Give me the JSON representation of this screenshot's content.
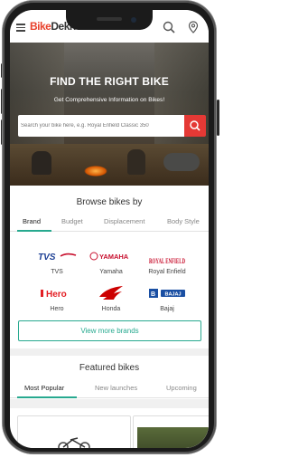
{
  "header": {
    "logo_a": "Bike",
    "logo_b": "Dekho",
    "icons": [
      "menu-icon",
      "search-icon",
      "location-pin-icon"
    ]
  },
  "hero": {
    "title": "FIND THE RIGHT BIKE",
    "subtitle": "Get Comprehensive Information on Bikes!",
    "search_placeholder": "Search your bike here, e.g. Royal Enfield Classic 350"
  },
  "browse": {
    "title": "Browse bikes by",
    "tabs": [
      {
        "label": "Brand",
        "active": true
      },
      {
        "label": "Budget",
        "active": false
      },
      {
        "label": "Displacement",
        "active": false
      },
      {
        "label": "Body Style",
        "active": false
      }
    ],
    "brands": [
      {
        "name": "TVS",
        "logo": "TVS",
        "color": "#1c3f94"
      },
      {
        "name": "Yamaha",
        "logo": "YAMAHA",
        "color": "#c8102e"
      },
      {
        "name": "Royal Enfield",
        "logo": "ROYAL ENFIELD",
        "color": "#c8102e"
      },
      {
        "name": "Hero",
        "logo": "Hero",
        "color": "#e31e24"
      },
      {
        "name": "Honda",
        "logo": "Honda",
        "color": "#cc0000"
      },
      {
        "name": "Bajaj",
        "logo": "BAJAJ",
        "color": "#1a4fa3"
      }
    ],
    "more_label": "View more brands"
  },
  "featured": {
    "title": "Featured bikes",
    "tabs": [
      {
        "label": "Most Popular",
        "active": true
      },
      {
        "label": "New launches",
        "active": false
      },
      {
        "label": "Upcoming",
        "active": false
      }
    ]
  },
  "colors": {
    "accent": "#27a98f",
    "brand_red": "#e53935"
  }
}
